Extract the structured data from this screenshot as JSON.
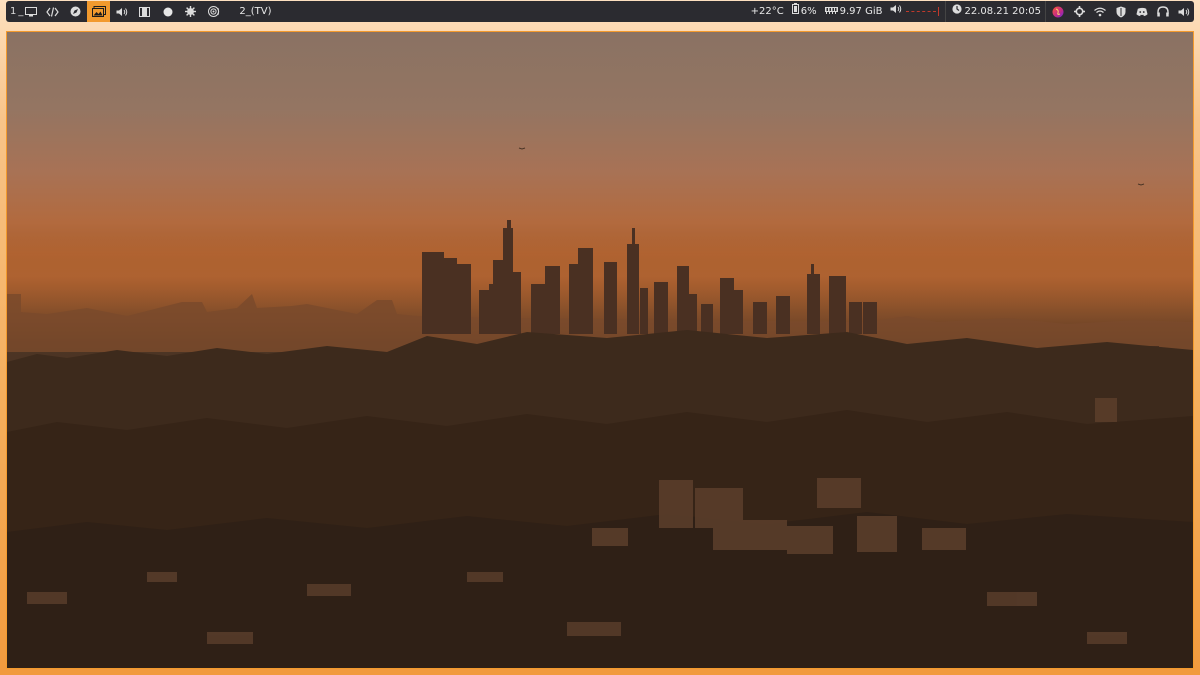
{
  "workspaces": [
    {
      "label": "1",
      "icon": "monitor-icon",
      "active": false
    },
    {
      "label": "",
      "icon": "code-icon",
      "active": false
    },
    {
      "label": "",
      "icon": "compass-icon",
      "active": false
    },
    {
      "label": "",
      "icon": "image-icon",
      "active": true
    },
    {
      "label": "",
      "icon": "speaker-icon",
      "active": false
    },
    {
      "label": "",
      "icon": "film-icon",
      "active": false
    },
    {
      "label": "",
      "icon": "circle-icon",
      "active": false
    },
    {
      "label": "",
      "icon": "gear-icon",
      "active": false
    },
    {
      "label": "",
      "icon": "target-icon",
      "active": false
    }
  ],
  "window_title": "2_(TV)",
  "status": {
    "temperature": "+22°C",
    "battery": "6%",
    "memory": "9.97 GiB",
    "datetime": "22.08.21 20:05"
  },
  "tray_icons": [
    "firefox-icon",
    "settings-icon",
    "wifi-icon",
    "shield-icon",
    "discord-icon",
    "headphones-icon",
    "volume-icon"
  ],
  "colors": {
    "bar_bg": "#2b2b30",
    "accent": "#f29a2e",
    "volume_bar": "#c0392b"
  }
}
